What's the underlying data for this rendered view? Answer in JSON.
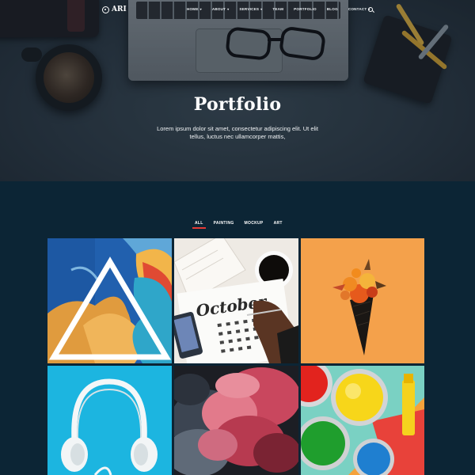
{
  "brand": {
    "name": "ARI",
    "logo_icon": "compass-icon"
  },
  "nav": {
    "items": [
      {
        "label": "HOME",
        "has_dropdown": true
      },
      {
        "label": "ABOUT",
        "has_dropdown": true
      },
      {
        "label": "SERVICES",
        "has_dropdown": true
      },
      {
        "label": "TEAM",
        "has_dropdown": false
      },
      {
        "label": "PORTFOLIO",
        "has_dropdown": false
      },
      {
        "label": "BLOG",
        "has_dropdown": false
      },
      {
        "label": "CONTACT",
        "has_dropdown": true
      }
    ],
    "search_icon": "search-icon"
  },
  "hero": {
    "title": "Portfolio",
    "subtitle": "Lorem ipsum dolor sit amet, consectetur adipiscing elit. Ut elit tellus, luctus nec ullamcorper mattis,"
  },
  "filters": {
    "items": [
      {
        "label": "ALL",
        "active": true
      },
      {
        "label": "PAINTING",
        "active": false
      },
      {
        "label": "MOCKUP",
        "active": false
      },
      {
        "label": "ART",
        "active": false
      }
    ],
    "active_color": "#e53935"
  },
  "portfolio": {
    "items": [
      {
        "subject": "triangle-mural"
      },
      {
        "subject": "october-calendar",
        "calendar_word": "October"
      },
      {
        "subject": "flower-ice-cream-cone"
      },
      {
        "subject": "white-headphones"
      },
      {
        "subject": "red-ink-smoke"
      },
      {
        "subject": "paint-cans"
      }
    ]
  },
  "colors": {
    "page_bg": "#0c2535",
    "hero_text": "#ffffff"
  }
}
